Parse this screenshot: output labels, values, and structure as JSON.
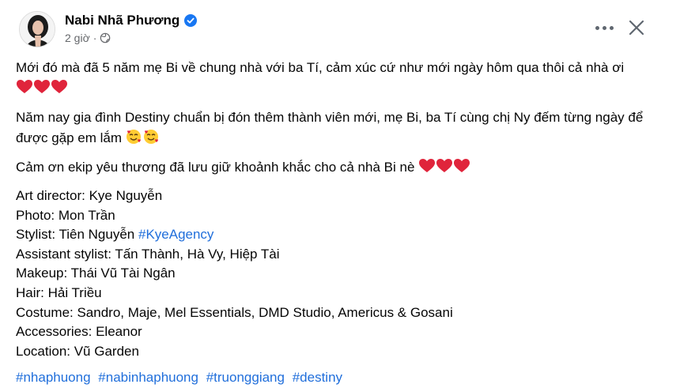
{
  "post": {
    "author": "Nabi Nhã Phương",
    "time": "2 giờ",
    "verified_icon": "verified-badge-icon",
    "privacy_icon": "globe-icon",
    "paragraphs": [
      "Mới đó mà đã 5 năm mẹ Bi về chung nhà với ba Tí, cảm xúc cứ như mới ngày hôm qua thôi cả nhà ơi",
      "Năm nay gia đình Destiny chuẩn bị đón thêm thành viên mới, mẹ Bi, ba Tí cùng chị Ny đếm từng ngày để được gặp em lắm",
      "Cảm ơn ekip yêu thương đã lưu giữ khoảnh khắc cho cả nhà Bi nè"
    ],
    "credits": [
      "Art director: Kye Nguyễn",
      "Photo: Mon Trần",
      "Stylist: Tiên Nguyễn",
      "Assistant stylist: Tấn Thành, Hà Vy, Hiệp Tài",
      "Makeup: Thái Vũ Tài Ngân",
      "Hair: Hải Triều",
      "Costume: Sandro, Maje, Mel Essentials, DMD Studio, Americus & Gosani",
      "Accessories: Eleanor",
      "Location: Vũ Garden"
    ],
    "stylist_tag": "#KyeAgency",
    "hashtags": [
      "#nhaphuong",
      "#nabinhaphuong",
      "#truonggiang",
      "#destiny"
    ]
  },
  "colors": {
    "link": "#216fdb",
    "meta": "#65676b",
    "heart": "#e0243b",
    "verified": "#1877f2"
  }
}
